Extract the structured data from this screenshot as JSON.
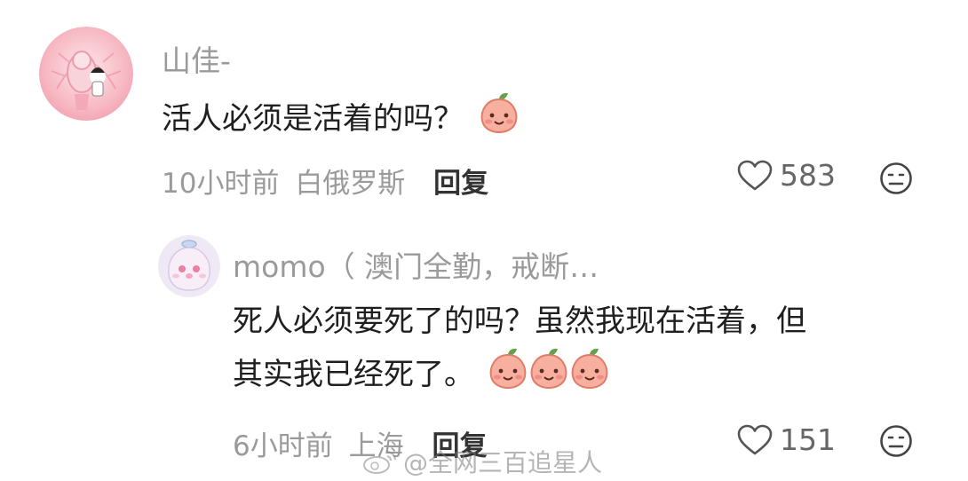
{
  "comment": {
    "username": "山佳-",
    "text": "活人必须是活着的吗？",
    "emoji": "peach-face-emoji",
    "time": "10小时前",
    "location": "白俄罗斯",
    "reply_label": "回复",
    "likes": "583"
  },
  "reply": {
    "username": "momo（ 澳门全勤，戒断…",
    "text_line1": "死人必须要死了的吗？虽然我现在活着，但",
    "text_line2": "其实我已经死了。",
    "emoji": "peach-face-emoji",
    "emoji_count": 3,
    "time": "6小时前",
    "location": "上海",
    "reply_label": "回复",
    "likes": "151"
  },
  "watermark": "@全网三百追星人",
  "colors": {
    "meta_gray": "#9a9a9a",
    "avatar_pink": "#f6b8c4",
    "peach": "#f6a79a"
  }
}
